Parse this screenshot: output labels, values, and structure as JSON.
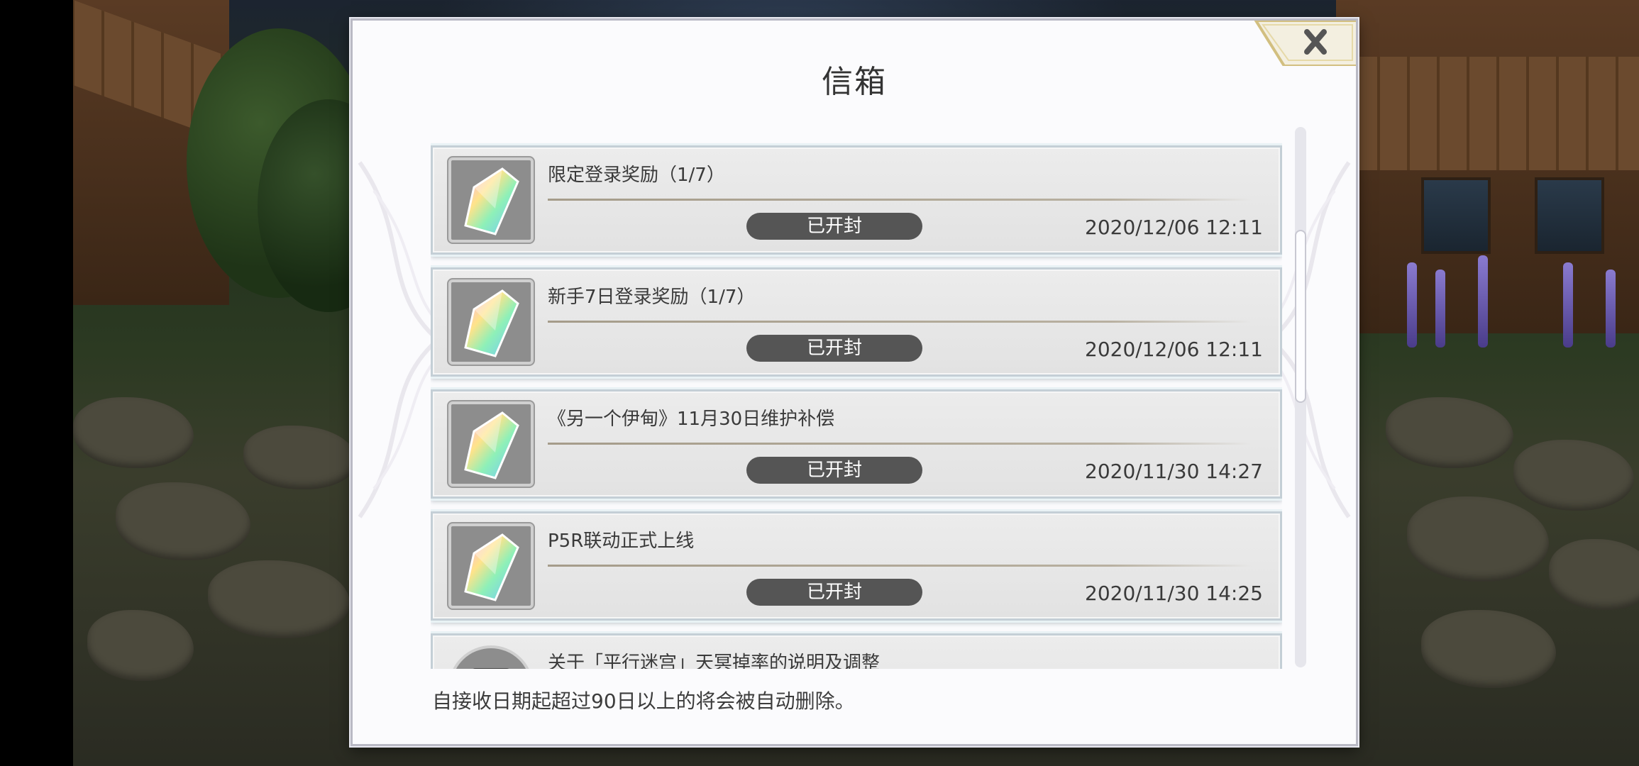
{
  "dialog": {
    "title": "信箱",
    "close_icon": "close-x-icon",
    "footer_note": "自接收日期起超过90日以上的将会被自动删除。"
  },
  "mails": [
    {
      "subject": "限定登录奖励（1/7）",
      "status": "已开封",
      "date": "2020/12/06 12:11",
      "icon": "rainbow-crystal-icon"
    },
    {
      "subject": "新手7日登录奖励（1/7）",
      "status": "已开封",
      "date": "2020/12/06 12:11",
      "icon": "rainbow-crystal-icon"
    },
    {
      "subject": "《另一个伊甸》11月30日维护补偿",
      "status": "已开封",
      "date": "2020/11/30 14:27",
      "icon": "rainbow-crystal-icon"
    },
    {
      "subject": "P5R联动正式上线",
      "status": "已开封",
      "date": "2020/11/30 14:25",
      "icon": "rainbow-crystal-icon"
    },
    {
      "subject": "关于「平行迷宫」天冥掉率的说明及调整",
      "status": "",
      "date": "",
      "icon": "notice-icon"
    }
  ],
  "scrollbar": {
    "position_fraction": 0.19,
    "visible_fraction": 0.32
  },
  "colors": {
    "status_pill": "#555555",
    "dialog_bg": "#fbfbfd",
    "item_bg": "#e6e6e6",
    "close_gold": "#d9c68a"
  }
}
